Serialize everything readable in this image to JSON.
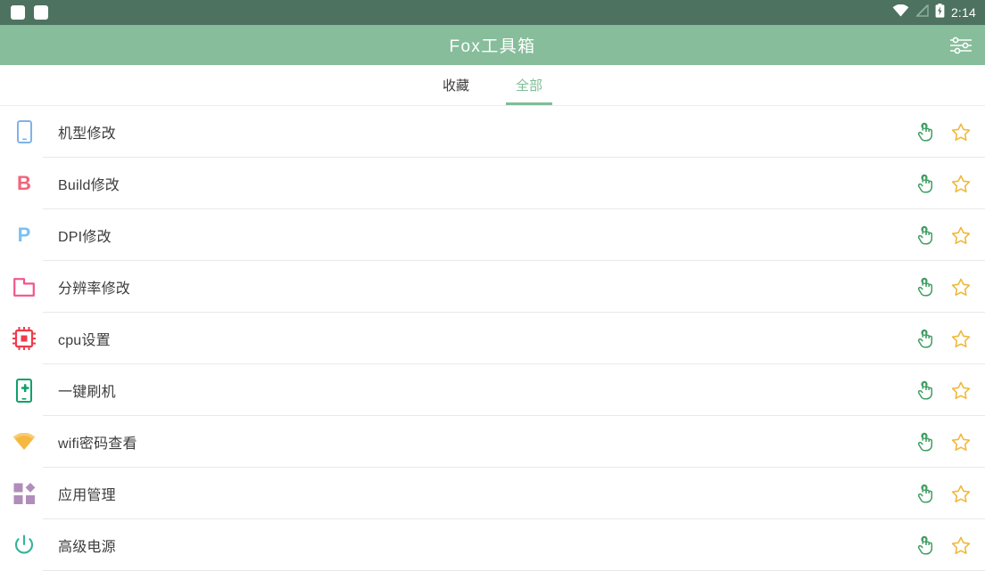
{
  "status_bar": {
    "notification_count": 2,
    "icons": [
      "wifi-icon",
      "signal-off-icon",
      "battery-charging-icon"
    ],
    "clock": "2:14",
    "background": "#4d7260"
  },
  "app_bar": {
    "title": "Fox工具箱",
    "action_icon": "tune-icon",
    "background": "#87bd9b",
    "title_color": "#ffffff"
  },
  "tabs": {
    "items": [
      {
        "label": "收藏",
        "active": false
      },
      {
        "label": "全部",
        "active": true
      }
    ],
    "active_color": "#7fbd97",
    "inactive_color": "#3b3b3b"
  },
  "list": {
    "action_labels": {
      "shortcut": "touch-shortcut-icon",
      "favorite": "star-outline-icon"
    },
    "action_colors": {
      "shortcut": "#3f9e62",
      "favorite": "#f0b83c"
    },
    "items": [
      {
        "label": "机型修改",
        "icon": "smartphone-icon",
        "color": "#7fb3e8"
      },
      {
        "label": "Build修改",
        "icon": "letter-b-icon",
        "color": "#f2647a",
        "glyph": "B"
      },
      {
        "label": "DPI修改",
        "icon": "letter-p-icon",
        "color": "#7cc0f0",
        "glyph": "P"
      },
      {
        "label": "分辨率修改",
        "icon": "crop-resolution-icon",
        "color": "#f2558c"
      },
      {
        "label": "cpu设置",
        "icon": "cpu-chip-icon",
        "color": "#ef3b4d"
      },
      {
        "label": "一键刷机",
        "icon": "phone-flash-icon",
        "color": "#12a06a"
      },
      {
        "label": "wifi密码查看",
        "icon": "wifi-full-icon",
        "color": "#f5b840"
      },
      {
        "label": "应用管理",
        "icon": "app-widgets-icon",
        "color": "#b08dba"
      },
      {
        "label": "高级电源",
        "icon": "power-icon",
        "color": "#35b39b"
      }
    ]
  }
}
